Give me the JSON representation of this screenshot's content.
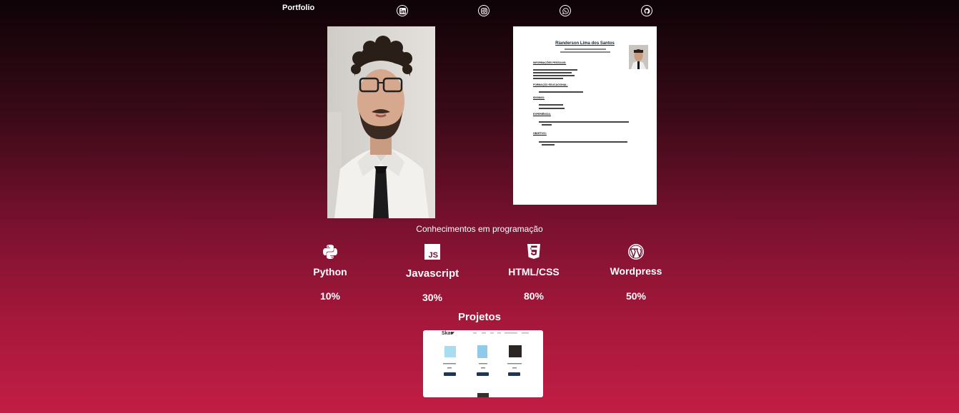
{
  "header": {
    "brand": "Portfolio",
    "social": [
      {
        "icon": "linkedin-icon"
      },
      {
        "icon": "instagram-icon"
      },
      {
        "icon": "whatsapp-icon"
      },
      {
        "icon": "github-icon"
      }
    ]
  },
  "cv": {
    "name": "Rianderson Lima dos Santos",
    "sections": [
      "INFORMAÇÕES PESSOAIS:",
      "FORMAÇÃO EDUCACIONAL:",
      "IDIOMAS:",
      "EXPERIÊNCIA:",
      "OBJETIVO:"
    ]
  },
  "skills": {
    "title": "Conhecimentos em programação",
    "items": [
      {
        "name": "Python",
        "percent": "10%",
        "icon": "python-icon"
      },
      {
        "name": "Javascript",
        "percent": "30%",
        "icon": "js-icon"
      },
      {
        "name": "HTML/CSS",
        "percent": "80%",
        "icon": "html5-icon"
      },
      {
        "name": "Wordpress",
        "percent": "50%",
        "icon": "wordpress-icon"
      }
    ]
  },
  "projects": {
    "title": "Projetos",
    "preview_logo": "Skar"
  },
  "colors": {
    "gradient_top": "#0d0306",
    "gradient_bottom": "#c21d45"
  }
}
